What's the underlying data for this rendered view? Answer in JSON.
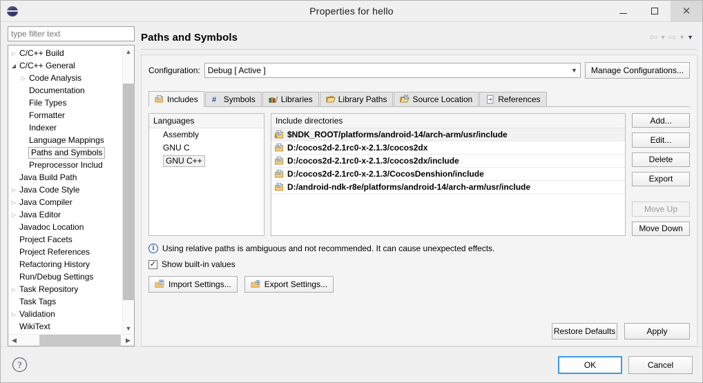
{
  "window": {
    "title": "Properties for hello",
    "logo_icon": "eclipse-globe-icon",
    "minimize_label": "–",
    "maximize_label": "❑",
    "close_label": "✕"
  },
  "tree_panel": {
    "filter_placeholder": "type filter text",
    "filter_value": "",
    "items": [
      {
        "label": "C/C++ Build",
        "indent": 1,
        "arrow": "collapsed",
        "selected": false
      },
      {
        "label": "C/C++ General",
        "indent": 1,
        "arrow": "expanded",
        "selected": false
      },
      {
        "label": "Code Analysis",
        "indent": 2,
        "arrow": "collapsed",
        "selected": false
      },
      {
        "label": "Documentation",
        "indent": 2,
        "arrow": "none",
        "selected": false
      },
      {
        "label": "File Types",
        "indent": 2,
        "arrow": "none",
        "selected": false
      },
      {
        "label": "Formatter",
        "indent": 2,
        "arrow": "none",
        "selected": false
      },
      {
        "label": "Indexer",
        "indent": 2,
        "arrow": "none",
        "selected": false
      },
      {
        "label": "Language Mappings",
        "indent": 2,
        "arrow": "none",
        "selected": false
      },
      {
        "label": "Paths and Symbols",
        "indent": 2,
        "arrow": "none",
        "selected": true
      },
      {
        "label": "Preprocessor Includ",
        "indent": 2,
        "arrow": "none",
        "selected": false
      },
      {
        "label": "Java Build Path",
        "indent": 1,
        "arrow": "none",
        "selected": false
      },
      {
        "label": "Java Code Style",
        "indent": 1,
        "arrow": "collapsed",
        "selected": false
      },
      {
        "label": "Java Compiler",
        "indent": 1,
        "arrow": "collapsed",
        "selected": false
      },
      {
        "label": "Java Editor",
        "indent": 1,
        "arrow": "collapsed",
        "selected": false
      },
      {
        "label": "Javadoc Location",
        "indent": 1,
        "arrow": "none",
        "selected": false
      },
      {
        "label": "Project Facets",
        "indent": 1,
        "arrow": "none",
        "selected": false
      },
      {
        "label": "Project References",
        "indent": 1,
        "arrow": "none",
        "selected": false
      },
      {
        "label": "Refactoring History",
        "indent": 1,
        "arrow": "none",
        "selected": false
      },
      {
        "label": "Run/Debug Settings",
        "indent": 1,
        "arrow": "none",
        "selected": false
      },
      {
        "label": "Task Repository",
        "indent": 1,
        "arrow": "collapsed",
        "selected": false
      },
      {
        "label": "Task Tags",
        "indent": 1,
        "arrow": "none",
        "selected": false
      },
      {
        "label": "Validation",
        "indent": 1,
        "arrow": "collapsed",
        "selected": false
      },
      {
        "label": "WikiText",
        "indent": 1,
        "arrow": "none",
        "selected": false
      }
    ]
  },
  "page": {
    "title": "Paths and Symbols",
    "nav": {
      "back_icon": "arrow-left-icon",
      "back_menu_icon": "chevron-down-icon",
      "forward_icon": "arrow-right-icon",
      "forward_menu_icon": "chevron-down-icon",
      "history_menu_icon": "chevron-down-icon"
    }
  },
  "configuration": {
    "label": "Configuration:",
    "value": "Debug  [ Active ]",
    "dropdown_icon": "chevron-down-icon",
    "manage_label": "Manage Configurations..."
  },
  "tabs": [
    {
      "label": "Includes",
      "icon": "include-folder-icon",
      "active": true
    },
    {
      "label": "Symbols",
      "icon": "hash-symbol-icon",
      "active": false
    },
    {
      "label": "Libraries",
      "icon": "books-icon",
      "active": false
    },
    {
      "label": "Library Paths",
      "icon": "open-folder-icon",
      "active": false
    },
    {
      "label": "Source Location",
      "icon": "source-folder-icon",
      "active": false
    },
    {
      "label": "References",
      "icon": "reference-page-icon",
      "active": false
    }
  ],
  "languages": {
    "header": "Languages",
    "items": [
      {
        "label": "Assembly",
        "selected": false
      },
      {
        "label": "GNU C",
        "selected": false
      },
      {
        "label": "GNU C++",
        "selected": true
      }
    ]
  },
  "include_directories": {
    "header": "Include directories",
    "rows": [
      {
        "path": "$NDK_ROOT/platforms/android-14/arch-arm/usr/include",
        "icon": "include-folder-warning-icon",
        "selected": true
      },
      {
        "path": "D:/cocos2d-2.1rc0-x-2.1.3/cocos2dx",
        "icon": "include-folder-icon",
        "selected": false
      },
      {
        "path": "D:/cocos2d-2.1rc0-x-2.1.3/cocos2dx/include",
        "icon": "include-folder-icon",
        "selected": false
      },
      {
        "path": "D:/cocos2d-2.1rc0-x-2.1.3/CocosDenshion/include",
        "icon": "include-folder-icon",
        "selected": false
      },
      {
        "path": "D:/android-ndk-r8e/platforms/android-14/arch-arm/usr/include",
        "icon": "include-folder-icon",
        "selected": false
      }
    ]
  },
  "side_buttons": [
    {
      "label": "Add...",
      "disabled": false
    },
    {
      "label": "Edit...",
      "disabled": false
    },
    {
      "label": "Delete",
      "disabled": false
    },
    {
      "label": "Export",
      "disabled": false
    },
    {
      "label": "Move Up",
      "disabled": true
    },
    {
      "label": "Move Down",
      "disabled": false
    }
  ],
  "info_message": {
    "icon": "info-icon",
    "text": "Using relative paths is ambiguous and not recommended. It can cause unexpected effects."
  },
  "show_builtin": {
    "label": "Show built-in values",
    "checked": true,
    "check_glyph": "✓"
  },
  "settings_buttons": [
    {
      "label": "Import Settings...",
      "icon": "import-settings-icon"
    },
    {
      "label": "Export Settings...",
      "icon": "export-settings-icon"
    }
  ],
  "apply_buttons": [
    {
      "label": "Restore Defaults"
    },
    {
      "label": "Apply"
    }
  ],
  "footer": {
    "help_icon": "help-question-icon",
    "help_glyph": "?",
    "ok_label": "OK",
    "cancel_label": "Cancel"
  },
  "colors": {
    "dialog_bg": "#f0f0f0",
    "panel_bg": "#f4f4f4",
    "list_bg": "#ffffff",
    "accent_focus": "#3b9ae1",
    "info_blue": "#1a5fb4",
    "selected_row": "#f2f2f2"
  }
}
